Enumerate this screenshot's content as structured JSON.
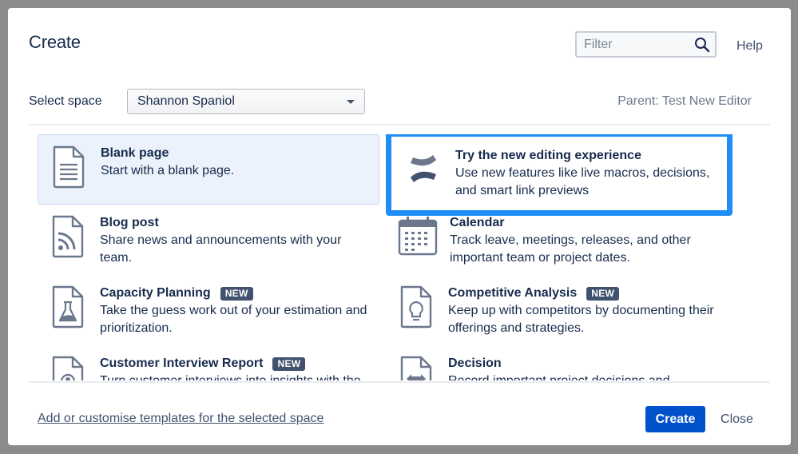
{
  "dialog": {
    "title": "Create",
    "filter_placeholder": "Filter",
    "help_label": "Help"
  },
  "space": {
    "label": "Select space",
    "selected": "Shannon Spaniol",
    "parent_text": "Parent: Test New Editor"
  },
  "templates": [
    {
      "name": "Blank page",
      "description": "Start with a blank page.",
      "badge": "",
      "icon": "document-icon",
      "state": "selected"
    },
    {
      "name": "Try the new editing experience",
      "description": "Use new features like live macros, decisions, and smart link previews",
      "badge": "",
      "icon": "confluence-logo-icon",
      "state": "highlighted"
    },
    {
      "name": "Blog post",
      "description": "Share news and announcements with your team.",
      "badge": "",
      "icon": "rss-feed-icon",
      "state": "normal"
    },
    {
      "name": "Calendar",
      "description": "Track leave, meetings, releases, and other important team or project dates.",
      "badge": "",
      "icon": "calendar-icon",
      "state": "normal"
    },
    {
      "name": "Capacity Planning",
      "description": "Take the guess work out of your estimation and prioritization.",
      "badge": "NEW",
      "icon": "flask-icon",
      "state": "normal"
    },
    {
      "name": "Competitive Analysis",
      "description": "Keep up with competitors by documenting their offerings and strategies.",
      "badge": "NEW",
      "icon": "lightbulb-icon",
      "state": "normal"
    },
    {
      "name": "Customer Interview Report",
      "description": "Turn customer interviews into insights with the",
      "badge": "NEW",
      "icon": "user-document-icon",
      "state": "normal"
    },
    {
      "name": "Decision",
      "description": "Record important project decisions and",
      "badge": "",
      "icon": "decision-arrows-icon",
      "state": "normal"
    }
  ],
  "footer": {
    "customise_link": "Add or customise templates for the selected space",
    "create_label": "Create",
    "close_label": "Close"
  },
  "colors": {
    "primary": "#0052cc",
    "highlight_border": "#1e8df5",
    "selected_bg": "#ebf2fb",
    "badge_bg": "#42526e"
  }
}
